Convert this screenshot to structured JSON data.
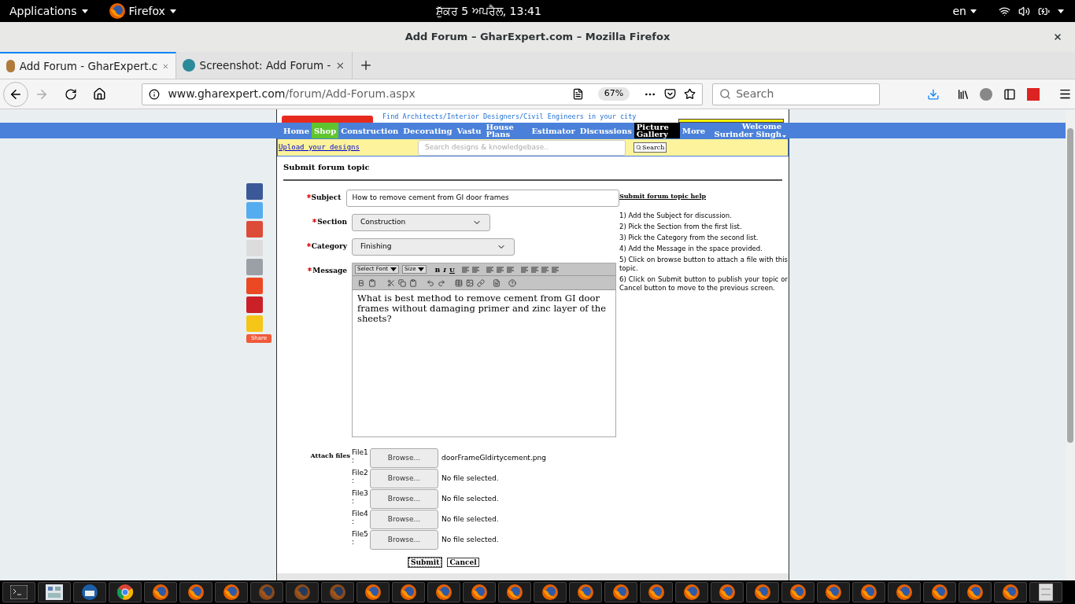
{
  "top_bar": {
    "applications": "Applications",
    "app": "Firefox",
    "clock": "ਸ਼ੁੱਕਰ  5 ਅਪਰੈਲ, 13:41",
    "language": "en"
  },
  "window": {
    "title": "Add Forum – GharExpert.com – Mozilla Firefox"
  },
  "tabs": [
    {
      "label": "Add Forum - GharExpert.c",
      "selected": true
    },
    {
      "label": "Screenshot: Add Forum -",
      "selected": false
    }
  ],
  "address_bar": {
    "domain": "www.gharexpert.com",
    "path": "/forum/Add-Forum.aspx",
    "zoom": "67%"
  },
  "search": {
    "placeholder": "Search"
  },
  "site": {
    "tagline": "Find Architects/Interior Designers/Civil Engineers in your city",
    "nav": [
      {
        "label": "Home",
        "kind": "plain"
      },
      {
        "label": "Shop",
        "kind": "green"
      },
      {
        "label": "Construction",
        "kind": "plain"
      },
      {
        "label": "Decorating",
        "kind": "plain"
      },
      {
        "label": "Vastu",
        "kind": "plain"
      },
      {
        "label": "House Plans",
        "kind": "plain"
      },
      {
        "label": "Estimator",
        "kind": "plain"
      },
      {
        "label": "Discussions",
        "kind": "plain"
      },
      {
        "label": "Picture Gallery",
        "kind": "dark"
      },
      {
        "label": "More",
        "kind": "plain"
      }
    ],
    "welcome": "Welcome Surinder Singh",
    "upload_link": "Upload your designs",
    "site_search": {
      "placeholder": "Search designs & knowledgebase..",
      "button": "Search"
    },
    "share": "Share"
  },
  "form": {
    "heading": "Submit forum topic",
    "fields": [
      {
        "label": "Subject",
        "kind": "text",
        "required": true,
        "value": "How to remove cement from GI door frames"
      },
      {
        "label": "Section",
        "kind": "select",
        "required": true,
        "value": "Construction"
      },
      {
        "label": "Category",
        "kind": "select",
        "required": true,
        "value": "Finishing"
      }
    ],
    "message": {
      "label": "Message",
      "required": true,
      "font_select": "Select Font",
      "size_select": "Size",
      "bold": "B",
      "italic": "I",
      "underline": "U",
      "text": "What is best method to remove cement from GI door frames without damaging primer and zinc layer of the sheets?"
    },
    "attach": {
      "label": "Attach files",
      "files": [
        {
          "label": "File1\n:",
          "button": "Browse...",
          "status": "doorFrameGIdirtycement.png"
        },
        {
          "label": "File2\n:",
          "button": "Browse...",
          "status": "No file selected."
        },
        {
          "label": "File3\n:",
          "button": "Browse...",
          "status": "No file selected."
        },
        {
          "label": "File4\n:",
          "button": "Browse...",
          "status": "No file selected."
        },
        {
          "label": "File5\n:",
          "button": "Browse...",
          "status": "No file selected."
        }
      ]
    },
    "buttons": [
      {
        "label": "Submit",
        "focused": true
      },
      {
        "label": "Cancel",
        "focused": false
      }
    ]
  },
  "help": {
    "title": "Submit forum topic help",
    "steps": [
      "1) Add the Subject for discussion.",
      "2) Pick the Section from the first list.",
      "3) Pick the Category from the second list.",
      "4) Add the Message in the space provided.",
      "5) Click on browse button to attach a file with this topic.",
      "6) Click on Submit button to publish your topic or Cancel button to move to the previous screen."
    ]
  }
}
